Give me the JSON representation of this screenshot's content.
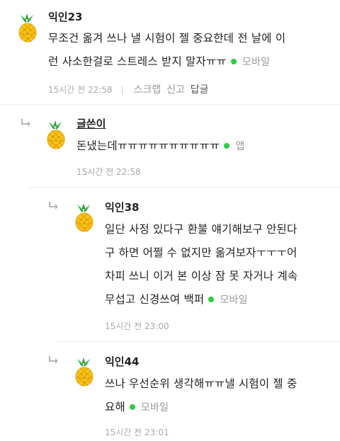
{
  "comments": [
    {
      "author": "익인23",
      "lines": [
        "무조건 옮겨 쓰나 낼 시험이 젤 중요한데 전 날에 이",
        "런 사소한걸로 스트레스 받지 말자ㅠㅠ"
      ],
      "device": "모바일",
      "time": "15시간 전 22:58",
      "actions": {
        "scrap": "스크랩",
        "report": "신고",
        "reply": "답글"
      }
    },
    {
      "author": "글쓴이",
      "lines": [
        "돈냈는데ㅠㅠㅠㅠㅠㅠㅠㅠㅠㅠ"
      ],
      "device": "앱",
      "time": "15시간 전 22:58"
    },
    {
      "author": "익인38",
      "lines": [
        "일단 사정 있다구 환불 얘기해보구 안된다",
        "구 하면 어쩔 수 없지만 옮겨보자ㅜㅜㅜ어",
        "차피 쓰니 이거 본 이상 잠 못 자거나 계속",
        "무섭고 신경쓰여 백퍼"
      ],
      "device": "모바일",
      "time": "15시간 전 23:00"
    },
    {
      "author": "익인44",
      "lines": [
        "쓰나 우선순위 생각해ㅠㅠ낼 시험이 젤 중",
        "요해"
      ],
      "device": "모바일",
      "time": "15시간 전 23:01"
    }
  ]
}
